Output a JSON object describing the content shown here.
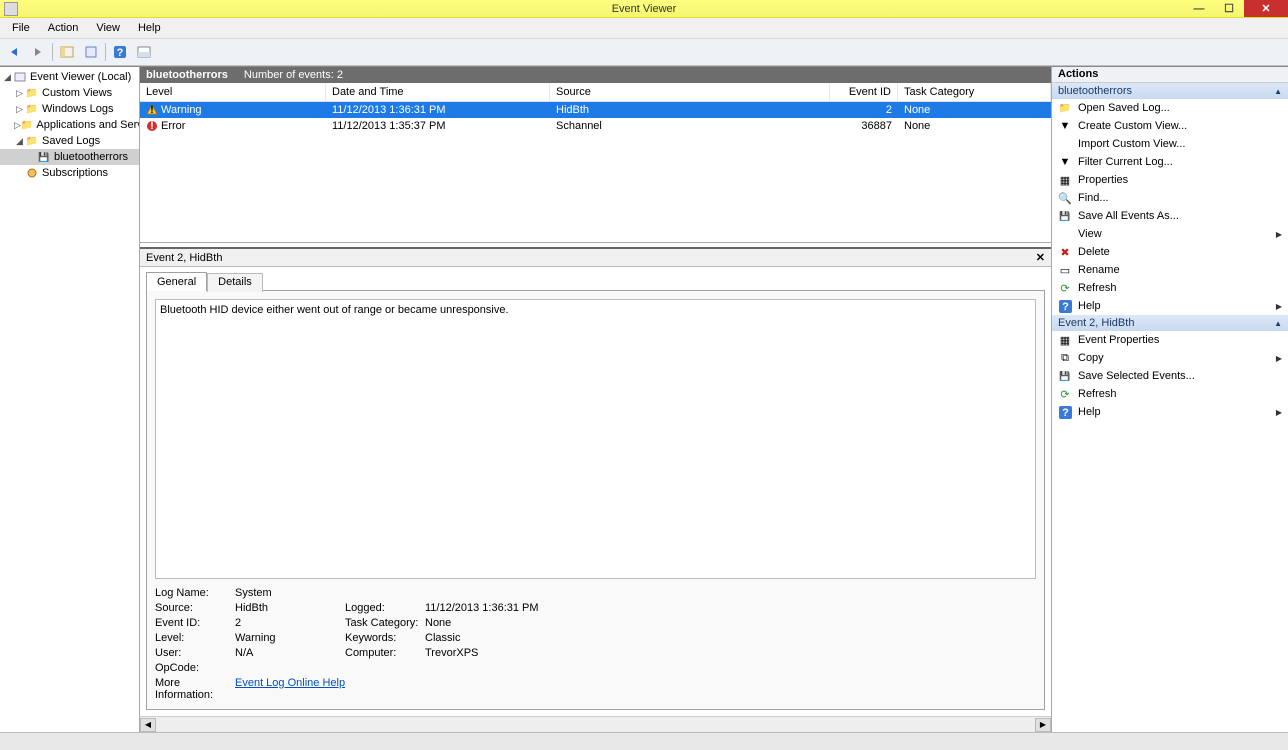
{
  "window": {
    "title": "Event Viewer"
  },
  "menu": [
    "File",
    "Action",
    "View",
    "Help"
  ],
  "tree": {
    "root": "Event Viewer (Local)",
    "custom": "Custom Views",
    "windows": "Windows Logs",
    "apps": "Applications and Services Lo",
    "saved": "Saved Logs",
    "bterr": "bluetootherrors",
    "subs": "Subscriptions"
  },
  "header": {
    "logname": "bluetootherrors",
    "count_label": "Number of events: 2"
  },
  "columns": {
    "level": "Level",
    "date": "Date and Time",
    "source": "Source",
    "id": "Event ID",
    "cat": "Task Category"
  },
  "rows": [
    {
      "level": "Warning",
      "date": "11/12/2013 1:36:31 PM",
      "source": "HidBth",
      "id": "2",
      "cat": "None",
      "sel": true,
      "icon": "warn"
    },
    {
      "level": "Error",
      "date": "11/12/2013 1:35:37 PM",
      "source": "Schannel",
      "id": "36887",
      "cat": "None",
      "sel": false,
      "icon": "err"
    }
  ],
  "detail": {
    "title": "Event 2, HidBth",
    "tab_general": "General",
    "tab_details": "Details",
    "message": "Bluetooth HID device  either went out of range or became unresponsive.",
    "labels": {
      "logname": "Log Name:",
      "source": "Source:",
      "eventid": "Event ID:",
      "level": "Level:",
      "user": "User:",
      "opcode": "OpCode:",
      "logged": "Logged:",
      "taskcat": "Task Category:",
      "keywords": "Keywords:",
      "computer": "Computer:",
      "moreinfo": "More Information:"
    },
    "values": {
      "logname": "System",
      "source": "HidBth",
      "eventid": "2",
      "level": "Warning",
      "user": "N/A",
      "opcode": "",
      "logged": "11/12/2013 1:36:31 PM",
      "taskcat": "None",
      "keywords": "Classic",
      "computer": "TrevorXPS",
      "help": "Event Log Online Help"
    }
  },
  "actions": {
    "header": "Actions",
    "sec1": "bluetootherrors",
    "sec2": "Event 2, HidBth",
    "a": {
      "open": "Open Saved Log...",
      "createcv": "Create Custom View...",
      "importcv": "Import Custom View...",
      "filter": "Filter Current Log...",
      "props": "Properties",
      "find": "Find...",
      "saveall": "Save All Events As...",
      "view": "View",
      "delete": "Delete",
      "rename": "Rename",
      "refresh": "Refresh",
      "help": "Help",
      "evprops": "Event Properties",
      "copy": "Copy",
      "savesel": "Save Selected Events...",
      "refresh2": "Refresh",
      "help2": "Help"
    }
  }
}
